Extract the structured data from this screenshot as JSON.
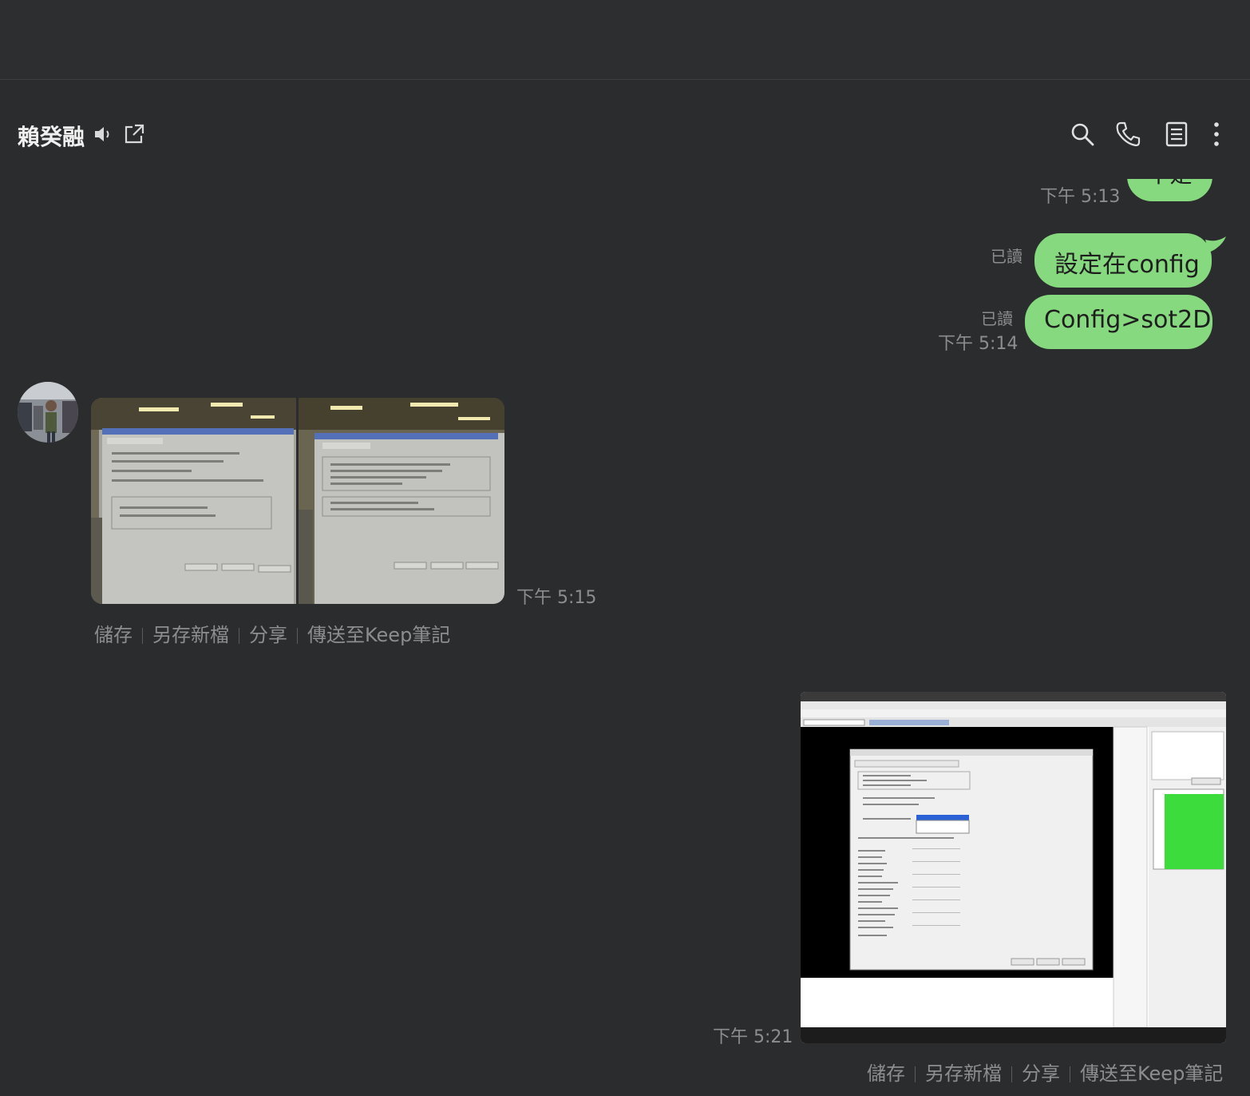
{
  "header": {
    "contact_name": "賴癸融",
    "icons": [
      "speaker-icon",
      "open-external-icon",
      "search-icon",
      "phone-icon",
      "notes-icon",
      "more-vertical-icon"
    ]
  },
  "messages": {
    "m1": {
      "partial_text": "不是",
      "time": "下午 5:13"
    },
    "m2": {
      "read": "已讀",
      "text": "設定在config"
    },
    "m3": {
      "read": "已讀",
      "time": "下午 5:14",
      "text": "Config>sot2D"
    },
    "m4": {
      "time": "下午 5:15"
    },
    "m5": {
      "time": "下午 5:21"
    }
  },
  "image_actions": {
    "save": "儲存",
    "save_as": "另存新檔",
    "share": "分享",
    "keep": "傳送至Keep筆記"
  },
  "colors": {
    "background": "#2b2c2e",
    "bubble": "#86d97e",
    "muted_text": "#8c8d90"
  }
}
